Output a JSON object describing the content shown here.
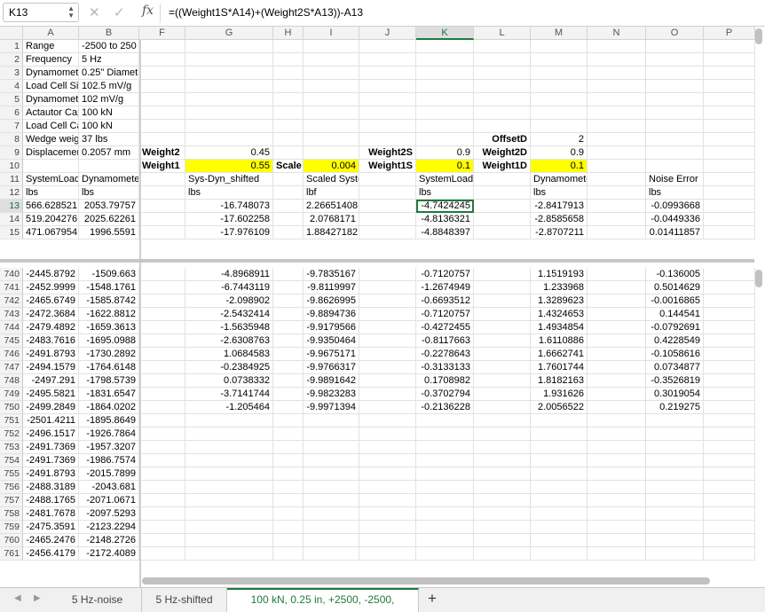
{
  "formula_bar": {
    "name_box": "K13",
    "fx": "fx",
    "formula": "=((Weight1S*A14)+(Weight2S*A13))-A13"
  },
  "columns": [
    "A",
    "B",
    "F",
    "G",
    "H",
    "I",
    "J",
    "K",
    "L",
    "M",
    "N",
    "O",
    "P"
  ],
  "selected_col": "K",
  "selected_row": 13,
  "top_rows": [
    {
      "n": "1",
      "cells": [
        {
          "c": "A",
          "t": "Range"
        },
        {
          "c": "B",
          "t": "-2500 to 250"
        }
      ]
    },
    {
      "n": "2",
      "cells": [
        {
          "c": "A",
          "t": "Frequency"
        },
        {
          "c": "B",
          "t": "5 Hz"
        }
      ]
    },
    {
      "n": "3",
      "cells": [
        {
          "c": "A",
          "t": "Dynamomete"
        },
        {
          "c": "B",
          "t": "0.25\" Diamet"
        }
      ]
    },
    {
      "n": "4",
      "cells": [
        {
          "c": "A",
          "t": "Load Cell Sid"
        },
        {
          "c": "B",
          "t": "102.5 mV/g"
        }
      ]
    },
    {
      "n": "5",
      "cells": [
        {
          "c": "A",
          "t": "Dynamomete"
        },
        {
          "c": "B",
          "t": "102 mV/g"
        }
      ]
    },
    {
      "n": "6",
      "cells": [
        {
          "c": "A",
          "t": "Actautor Cap"
        },
        {
          "c": "B",
          "t": "100 kN"
        }
      ]
    },
    {
      "n": "7",
      "cells": [
        {
          "c": "A",
          "t": "Load Cell Ca"
        },
        {
          "c": "B",
          "t": "100 kN"
        }
      ]
    },
    {
      "n": "8",
      "cells": [
        {
          "c": "A",
          "t": "Wedge weig"
        },
        {
          "c": "B",
          "t": "37 lbs"
        },
        {
          "c": "L",
          "t": "OffsetD",
          "s": "bold num"
        },
        {
          "c": "M",
          "t": "2",
          "s": "num"
        }
      ]
    },
    {
      "n": "9",
      "cells": [
        {
          "c": "A",
          "t": "Displacemen"
        },
        {
          "c": "B",
          "t": "0.2057 mm"
        },
        {
          "c": "F",
          "t": "Weight2",
          "s": "bold"
        },
        {
          "c": "G",
          "t": "0.45",
          "s": "num"
        },
        {
          "c": "J",
          "t": "Weight2S",
          "s": "bold num"
        },
        {
          "c": "K",
          "t": "0.9",
          "s": "num"
        },
        {
          "c": "L",
          "t": "Weight2D",
          "s": "bold num"
        },
        {
          "c": "M",
          "t": "0.9",
          "s": "num"
        }
      ]
    },
    {
      "n": "10",
      "cells": [
        {
          "c": "F",
          "t": "Weight1",
          "s": "bold"
        },
        {
          "c": "G",
          "t": "0.55",
          "s": "num yellow"
        },
        {
          "c": "H",
          "t": "Scale",
          "s": "bold num"
        },
        {
          "c": "I",
          "t": "0.004",
          "s": "num yellow"
        },
        {
          "c": "J",
          "t": "Weight1S",
          "s": "bold num"
        },
        {
          "c": "K",
          "t": "0.1",
          "s": "num yellow"
        },
        {
          "c": "L",
          "t": "Weight1D",
          "s": "bold num"
        },
        {
          "c": "M",
          "t": "0.1",
          "s": "num yellow"
        }
      ]
    },
    {
      "n": "11",
      "cells": [
        {
          "c": "A",
          "t": "SystemLoad"
        },
        {
          "c": "B",
          "t": "Dynamomete"
        },
        {
          "c": "G",
          "t": "Sys-Dyn_shifted"
        },
        {
          "c": "I",
          "t": "Scaled System"
        },
        {
          "c": "K",
          "t": "SystemLoadNoise"
        },
        {
          "c": "M",
          "t": "DynamometerNoise"
        },
        {
          "c": "O",
          "t": "Noise Error"
        }
      ]
    },
    {
      "n": "12",
      "cells": [
        {
          "c": "A",
          "t": "lbs"
        },
        {
          "c": "B",
          "t": "lbs"
        },
        {
          "c": "G",
          "t": "lbs"
        },
        {
          "c": "I",
          "t": "lbf"
        },
        {
          "c": "K",
          "t": "lbs"
        },
        {
          "c": "M",
          "t": "lbs"
        },
        {
          "c": "O",
          "t": "lbs"
        }
      ]
    },
    {
      "n": "13",
      "cells": [
        {
          "c": "A",
          "t": "566.628521",
          "s": "num"
        },
        {
          "c": "B",
          "t": "2053.79757",
          "s": "num"
        },
        {
          "c": "G",
          "t": "-16.748073",
          "s": "num"
        },
        {
          "c": "I",
          "t": "2.26651408",
          "s": "num"
        },
        {
          "c": "K",
          "t": "-4.7424245",
          "s": "num sel"
        },
        {
          "c": "M",
          "t": "-2.8417913",
          "s": "num"
        },
        {
          "c": "O",
          "t": "-0.0993668",
          "s": "num"
        }
      ]
    },
    {
      "n": "14",
      "cells": [
        {
          "c": "A",
          "t": "519.204276",
          "s": "num"
        },
        {
          "c": "B",
          "t": "2025.62261",
          "s": "num"
        },
        {
          "c": "G",
          "t": "-17.602258",
          "s": "num"
        },
        {
          "c": "I",
          "t": "2.0768171",
          "s": "num"
        },
        {
          "c": "K",
          "t": "-4.8136321",
          "s": "num"
        },
        {
          "c": "M",
          "t": "-2.8585658",
          "s": "num"
        },
        {
          "c": "O",
          "t": "-0.0449336",
          "s": "num"
        }
      ]
    },
    {
      "n": "15",
      "cells": [
        {
          "c": "A",
          "t": "471.067954",
          "s": "num"
        },
        {
          "c": "B",
          "t": "1996.5591",
          "s": "num"
        },
        {
          "c": "G",
          "t": "-17.976109",
          "s": "num"
        },
        {
          "c": "I",
          "t": "1.88427182",
          "s": "num"
        },
        {
          "c": "K",
          "t": "-4.8848397",
          "s": "num"
        },
        {
          "c": "M",
          "t": "-2.8707211",
          "s": "num"
        },
        {
          "c": "O",
          "t": "0.01411857",
          "s": "num"
        }
      ]
    }
  ],
  "bottom_rows": [
    {
      "n": "740",
      "cells": [
        {
          "c": "A",
          "t": "-2445.8792",
          "s": "num"
        },
        {
          "c": "B",
          "t": "-1509.663",
          "s": "num"
        },
        {
          "c": "G",
          "t": "-4.8968911",
          "s": "num"
        },
        {
          "c": "I",
          "t": "-9.7835167",
          "s": "num"
        },
        {
          "c": "K",
          "t": "-0.7120757",
          "s": "num"
        },
        {
          "c": "M",
          "t": "1.1519193",
          "s": "num"
        },
        {
          "c": "O",
          "t": "-0.136005",
          "s": "num"
        }
      ]
    },
    {
      "n": "741",
      "cells": [
        {
          "c": "A",
          "t": "-2452.9999",
          "s": "num"
        },
        {
          "c": "B",
          "t": "-1548.1761",
          "s": "num"
        },
        {
          "c": "G",
          "t": "-6.7443119",
          "s": "num"
        },
        {
          "c": "I",
          "t": "-9.8119997",
          "s": "num"
        },
        {
          "c": "K",
          "t": "-1.2674949",
          "s": "num"
        },
        {
          "c": "M",
          "t": "1.233968",
          "s": "num"
        },
        {
          "c": "O",
          "t": "0.5014629",
          "s": "num"
        }
      ]
    },
    {
      "n": "742",
      "cells": [
        {
          "c": "A",
          "t": "-2465.6749",
          "s": "num"
        },
        {
          "c": "B",
          "t": "-1585.8742",
          "s": "num"
        },
        {
          "c": "G",
          "t": "-2.098902",
          "s": "num"
        },
        {
          "c": "I",
          "t": "-9.8626995",
          "s": "num"
        },
        {
          "c": "K",
          "t": "-0.6693512",
          "s": "num"
        },
        {
          "c": "M",
          "t": "1.3289623",
          "s": "num"
        },
        {
          "c": "O",
          "t": "-0.0016865",
          "s": "num"
        }
      ]
    },
    {
      "n": "743",
      "cells": [
        {
          "c": "A",
          "t": "-2472.3684",
          "s": "num"
        },
        {
          "c": "B",
          "t": "-1622.8812",
          "s": "num"
        },
        {
          "c": "G",
          "t": "-2.5432414",
          "s": "num"
        },
        {
          "c": "I",
          "t": "-9.8894736",
          "s": "num"
        },
        {
          "c": "K",
          "t": "-0.7120757",
          "s": "num"
        },
        {
          "c": "M",
          "t": "1.4324653",
          "s": "num"
        },
        {
          "c": "O",
          "t": "0.144541",
          "s": "num"
        }
      ]
    },
    {
      "n": "744",
      "cells": [
        {
          "c": "A",
          "t": "-2479.4892",
          "s": "num"
        },
        {
          "c": "B",
          "t": "-1659.3613",
          "s": "num"
        },
        {
          "c": "G",
          "t": "-1.5635948",
          "s": "num"
        },
        {
          "c": "I",
          "t": "-9.9179566",
          "s": "num"
        },
        {
          "c": "K",
          "t": "-0.4272455",
          "s": "num"
        },
        {
          "c": "M",
          "t": "1.4934854",
          "s": "num"
        },
        {
          "c": "O",
          "t": "-0.0792691",
          "s": "num"
        }
      ]
    },
    {
      "n": "745",
      "cells": [
        {
          "c": "A",
          "t": "-2483.7616",
          "s": "num"
        },
        {
          "c": "B",
          "t": "-1695.0988",
          "s": "num"
        },
        {
          "c": "G",
          "t": "-2.6308763",
          "s": "num"
        },
        {
          "c": "I",
          "t": "-9.9350464",
          "s": "num"
        },
        {
          "c": "K",
          "t": "-0.8117663",
          "s": "num"
        },
        {
          "c": "M",
          "t": "1.6110886",
          "s": "num"
        },
        {
          "c": "O",
          "t": "0.4228549",
          "s": "num"
        }
      ]
    },
    {
      "n": "746",
      "cells": [
        {
          "c": "A",
          "t": "-2491.8793",
          "s": "num"
        },
        {
          "c": "B",
          "t": "-1730.2892",
          "s": "num"
        },
        {
          "c": "G",
          "t": "1.0684583",
          "s": "num"
        },
        {
          "c": "I",
          "t": "-9.9675171",
          "s": "num"
        },
        {
          "c": "K",
          "t": "-0.2278643",
          "s": "num"
        },
        {
          "c": "M",
          "t": "1.6662741",
          "s": "num"
        },
        {
          "c": "O",
          "t": "-0.1058616",
          "s": "num"
        }
      ]
    },
    {
      "n": "747",
      "cells": [
        {
          "c": "A",
          "t": "-2494.1579",
          "s": "num"
        },
        {
          "c": "B",
          "t": "-1764.6148",
          "s": "num"
        },
        {
          "c": "G",
          "t": "-0.2384925",
          "s": "num"
        },
        {
          "c": "I",
          "t": "-9.9766317",
          "s": "num"
        },
        {
          "c": "K",
          "t": "-0.3133133",
          "s": "num"
        },
        {
          "c": "M",
          "t": "1.7601744",
          "s": "num"
        },
        {
          "c": "O",
          "t": "0.0734877",
          "s": "num"
        }
      ]
    },
    {
      "n": "748",
      "cells": [
        {
          "c": "A",
          "t": "-2497.291",
          "s": "num"
        },
        {
          "c": "B",
          "t": "-1798.5739",
          "s": "num"
        },
        {
          "c": "G",
          "t": "0.0738332",
          "s": "num"
        },
        {
          "c": "I",
          "t": "-9.9891642",
          "s": "num"
        },
        {
          "c": "K",
          "t": "0.1708982",
          "s": "num"
        },
        {
          "c": "M",
          "t": "1.8182163",
          "s": "num"
        },
        {
          "c": "O",
          "t": "-0.3526819",
          "s": "num"
        }
      ]
    },
    {
      "n": "749",
      "cells": [
        {
          "c": "A",
          "t": "-2495.5821",
          "s": "num"
        },
        {
          "c": "B",
          "t": "-1831.6547",
          "s": "num"
        },
        {
          "c": "G",
          "t": "-3.7141744",
          "s": "num"
        },
        {
          "c": "I",
          "t": "-9.9823283",
          "s": "num"
        },
        {
          "c": "K",
          "t": "-0.3702794",
          "s": "num"
        },
        {
          "c": "M",
          "t": "1.931626",
          "s": "num"
        },
        {
          "c": "O",
          "t": "0.3019054",
          "s": "num"
        }
      ]
    },
    {
      "n": "750",
      "cells": [
        {
          "c": "A",
          "t": "-2499.2849",
          "s": "num"
        },
        {
          "c": "B",
          "t": "-1864.0202",
          "s": "num"
        },
        {
          "c": "G",
          "t": "-1.205464",
          "s": "num"
        },
        {
          "c": "I",
          "t": "-9.9971394",
          "s": "num"
        },
        {
          "c": "K",
          "t": "-0.2136228",
          "s": "num"
        },
        {
          "c": "M",
          "t": "2.0056522",
          "s": "num"
        },
        {
          "c": "O",
          "t": "0.219275",
          "s": "num"
        }
      ]
    },
    {
      "n": "751",
      "cells": [
        {
          "c": "A",
          "t": "-2501.4211",
          "s": "num"
        },
        {
          "c": "B",
          "t": "-1895.8649",
          "s": "num"
        }
      ]
    },
    {
      "n": "752",
      "cells": [
        {
          "c": "A",
          "t": "-2496.1517",
          "s": "num"
        },
        {
          "c": "B",
          "t": "-1926.7864",
          "s": "num"
        }
      ]
    },
    {
      "n": "753",
      "cells": [
        {
          "c": "A",
          "t": "-2491.7369",
          "s": "num"
        },
        {
          "c": "B",
          "t": "-1957.3207",
          "s": "num"
        }
      ]
    },
    {
      "n": "754",
      "cells": [
        {
          "c": "A",
          "t": "-2491.7369",
          "s": "num"
        },
        {
          "c": "B",
          "t": "-1986.7574",
          "s": "num"
        }
      ]
    },
    {
      "n": "755",
      "cells": [
        {
          "c": "A",
          "t": "-2491.8793",
          "s": "num"
        },
        {
          "c": "B",
          "t": "-2015.7899",
          "s": "num"
        }
      ]
    },
    {
      "n": "756",
      "cells": [
        {
          "c": "A",
          "t": "-2488.3189",
          "s": "num"
        },
        {
          "c": "B",
          "t": "-2043.681",
          "s": "num"
        }
      ]
    },
    {
      "n": "757",
      "cells": [
        {
          "c": "A",
          "t": "-2488.1765",
          "s": "num"
        },
        {
          "c": "B",
          "t": "-2071.0671",
          "s": "num"
        }
      ]
    },
    {
      "n": "758",
      "cells": [
        {
          "c": "A",
          "t": "-2481.7678",
          "s": "num"
        },
        {
          "c": "B",
          "t": "-2097.5293",
          "s": "num"
        }
      ]
    },
    {
      "n": "759",
      "cells": [
        {
          "c": "A",
          "t": "-2475.3591",
          "s": "num"
        },
        {
          "c": "B",
          "t": "-2123.2294",
          "s": "num"
        }
      ]
    },
    {
      "n": "760",
      "cells": [
        {
          "c": "A",
          "t": "-2465.2476",
          "s": "num"
        },
        {
          "c": "B",
          "t": "-2148.2726",
          "s": "num"
        }
      ]
    },
    {
      "n": "761",
      "cells": [
        {
          "c": "A",
          "t": "-2456.4179",
          "s": "num"
        },
        {
          "c": "B",
          "t": "-2172.4089",
          "s": "num"
        }
      ]
    }
  ],
  "sheet_tabs": [
    {
      "label": "5 Hz-noise",
      "active": false
    },
    {
      "label": "5 Hz-shifted",
      "active": false
    },
    {
      "label": "100 kN, 0.25 in, +2500, -2500,",
      "active": true
    }
  ],
  "add_sheet_label": "+"
}
